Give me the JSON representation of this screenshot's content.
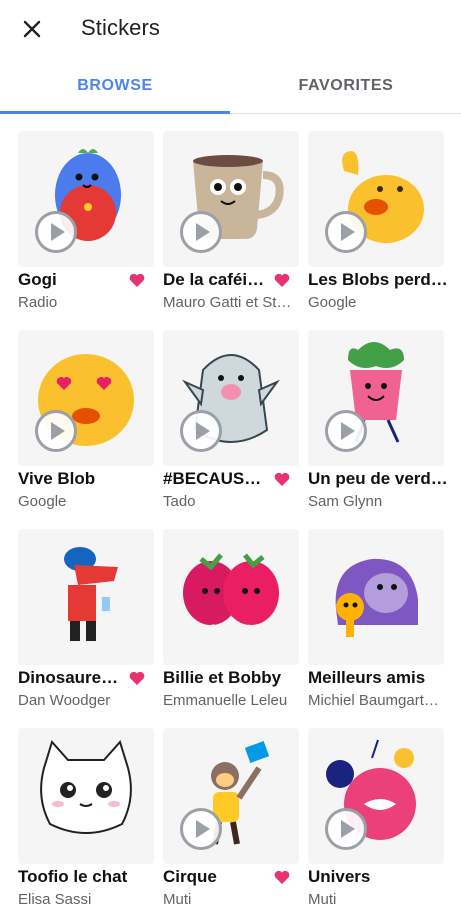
{
  "header": {
    "title": "Stickers"
  },
  "tabs": [
    {
      "label": "BROWSE",
      "active": true
    },
    {
      "label": "FAVORITES",
      "active": false
    }
  ],
  "colors": {
    "accent": "#4a86e8",
    "heart": "#e8336f"
  },
  "packs": [
    {
      "name": "Gogi",
      "author": "Radio",
      "favorite": true,
      "animated": true
    },
    {
      "name": "De la caféi…",
      "author": "Mauro Gatti et St…",
      "favorite": true,
      "animated": true
    },
    {
      "name": "Les Blobs perd…",
      "author": "Google",
      "favorite": false,
      "animated": true
    },
    {
      "name": "Vive Blob",
      "author": "Google",
      "favorite": false,
      "animated": true
    },
    {
      "name": "#BECAUS…",
      "author": "Tado",
      "favorite": true,
      "animated": true
    },
    {
      "name": "Un peu de verd…",
      "author": "Sam Glynn",
      "favorite": false,
      "animated": true
    },
    {
      "name": "Dinosaure…",
      "author": "Dan Woodger",
      "favorite": true,
      "animated": false
    },
    {
      "name": "Billie et Bobby",
      "author": "Emmanuelle Leleu",
      "favorite": false,
      "animated": false
    },
    {
      "name": "Meilleurs amis",
      "author": "Michiel Baumgart…",
      "favorite": false,
      "animated": false
    },
    {
      "name": "Toofio le chat",
      "author": "Elisa Sassi",
      "favorite": false,
      "animated": false
    },
    {
      "name": "Cirque",
      "author": "Muti",
      "favorite": true,
      "animated": true
    },
    {
      "name": "Univers",
      "author": "Muti",
      "favorite": false,
      "animated": true
    }
  ]
}
